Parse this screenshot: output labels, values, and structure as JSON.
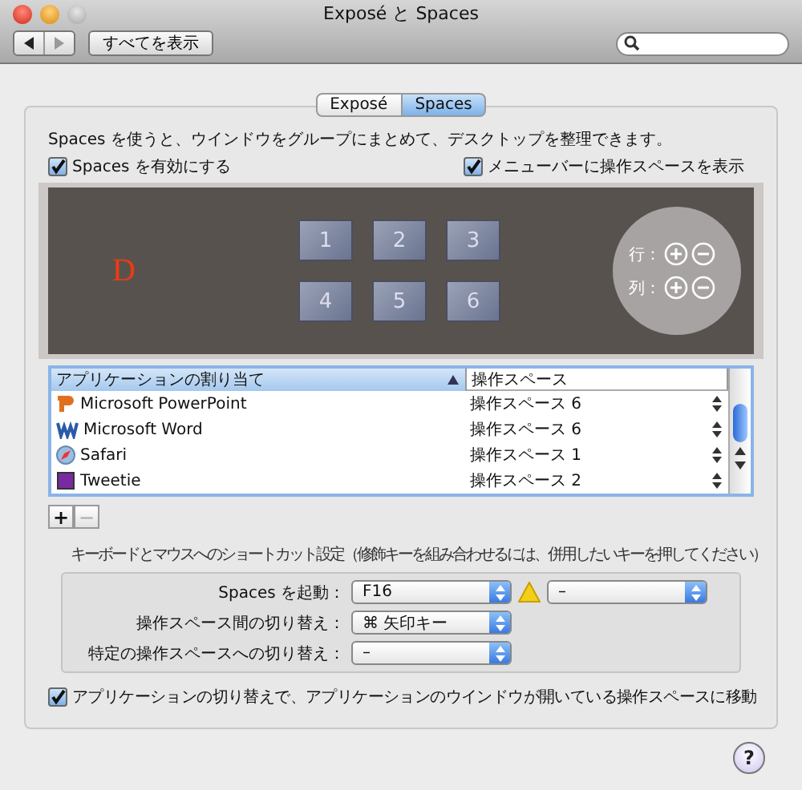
{
  "window": {
    "title": "Exposé と Spaces"
  },
  "toolbar": {
    "show_all_button": "すべてを表示"
  },
  "tabs": [
    {
      "label": "Exposé",
      "selected": false
    },
    {
      "label": "Spaces",
      "selected": true
    }
  ],
  "description": "Spaces を使うと、ウインドウをグループにまとめて、デスクトップを整理できます。",
  "checkboxes": [
    {
      "label": "Spaces を有効にする",
      "checked": true
    },
    {
      "label": "メニューバーに操作スペースを表示",
      "checked": true
    }
  ],
  "spaces_preview": {
    "desktop_letter": "D",
    "spaces": [
      "1",
      "2",
      "3",
      "4",
      "5",
      "6"
    ],
    "rows_label": "行：",
    "columns_label": "列："
  },
  "assignments": {
    "columns": [
      "アプリケーションの割り当て",
      "操作スペース"
    ],
    "rows": [
      {
        "kind": "presentation",
        "app": "Microsoft PowerPoint",
        "space": "操作スペース 6"
      },
      {
        "kind": "document",
        "app": "Microsoft Word",
        "space": "操作スペース 6"
      },
      {
        "kind": "compass",
        "app": "Safari",
        "space": "操作スペース 1"
      },
      {
        "kind": "square",
        "app": "Tweetie",
        "space": "操作スペース 2"
      }
    ]
  },
  "list_buttons": [
    {
      "label": "+",
      "disabled": false
    },
    {
      "label": "−",
      "disabled": true
    }
  ],
  "shortcuts": {
    "heading": "キーボードとマウスへのショートカット設定（修飾キーを組み合わせるには、併用したいキーを押してください）",
    "rows": [
      {
        "label": "Spaces を起動：",
        "value": "F16",
        "warning": true,
        "secondary": "–"
      },
      {
        "label": "操作スペース間の切り替え：",
        "value": "⌘ 矢印キー",
        "warning": false
      },
      {
        "label": "特定の操作スペースへの切り替え：",
        "value": "–",
        "warning": false
      }
    ]
  },
  "move_on_switch": {
    "label": "アプリケーションの切り替えで、アプリケーションのウインドウが開いている操作スペースに移動",
    "checked": true
  },
  "help_button": "?"
}
